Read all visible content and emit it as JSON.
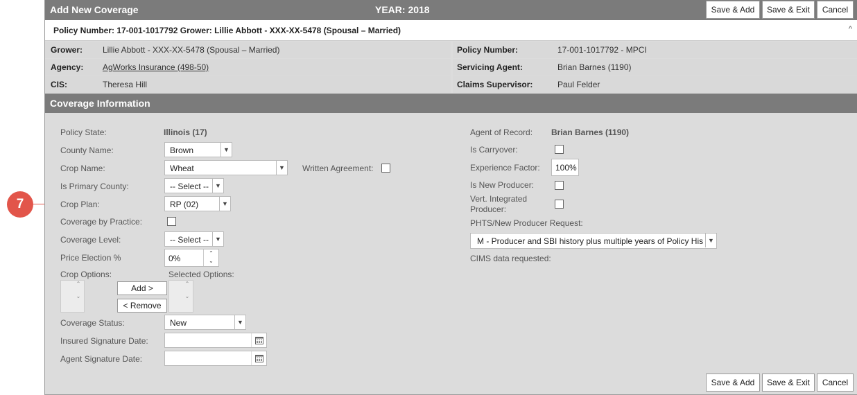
{
  "callout": {
    "number": "7"
  },
  "header": {
    "title": "Add New Coverage",
    "year": "YEAR: 2018",
    "save_add": "Save & Add",
    "save_exit": "Save & Exit",
    "cancel": "Cancel"
  },
  "policy_bar": {
    "text": "Policy Number: 17-001-1017792 Grower: Lillie Abbott - XXX-XX-5478 (Spousal – Married)",
    "chevron": "^"
  },
  "info": {
    "grower_label": "Grower:",
    "grower_value": "Lillie Abbott - XXX-XX-5478 (Spousal – Married)",
    "policy_label": "Policy Number:",
    "policy_value": "17-001-1017792 - MPCI",
    "agency_label": "Agency:",
    "agency_value": "AgWorks Insurance (498-50)",
    "servicing_label": "Servicing Agent:",
    "servicing_value": "Brian Barnes (1190)",
    "cis_label": "CIS:",
    "cis_value": "Theresa Hill",
    "claims_label": "Claims Supervisor:",
    "claims_value": "Paul Felder"
  },
  "section": {
    "title": "Coverage Information"
  },
  "form": {
    "policy_state_label": "Policy State:",
    "policy_state_value": "Illinois (17)",
    "county_label": "County Name:",
    "county_value": "Brown",
    "crop_label": "Crop Name:",
    "crop_value": "Wheat",
    "written_agreement_label": "Written Agreement:",
    "primary_county_label": "Is Primary County:",
    "primary_county_value": "-- Select --",
    "crop_plan_label": "Crop Plan:",
    "crop_plan_value": "RP (02)",
    "coverage_by_practice_label": "Coverage by Practice:",
    "coverage_level_label": "Coverage Level:",
    "coverage_level_value": "-- Select --",
    "price_election_label": "Price Election %",
    "price_election_value": "0%",
    "crop_options_label": "Crop Options:",
    "selected_options_label": "Selected Options:",
    "add_btn": "Add >",
    "remove_btn": "< Remove",
    "coverage_status_label": "Coverage Status:",
    "coverage_status_value": "New",
    "insured_sig_label": "Insured Signature Date:",
    "insured_sig_value": "",
    "agent_sig_label": "Agent Signature Date:",
    "agent_sig_value": "",
    "agent_record_label": "Agent of Record:",
    "agent_record_value": "Brian Barnes (1190)",
    "carryover_label": "Is Carryover:",
    "experience_label": "Experience Factor:",
    "experience_value": "100%",
    "new_producer_label": "Is New Producer:",
    "vert_label_1": "Vert. Integrated",
    "vert_label_2": "Producer:",
    "phts_label": "PHTS/New Producer Request:",
    "phts_value": "M - Producer and SBI history plus multiple years of Policy His",
    "cims_label": "CIMS data requested:"
  }
}
